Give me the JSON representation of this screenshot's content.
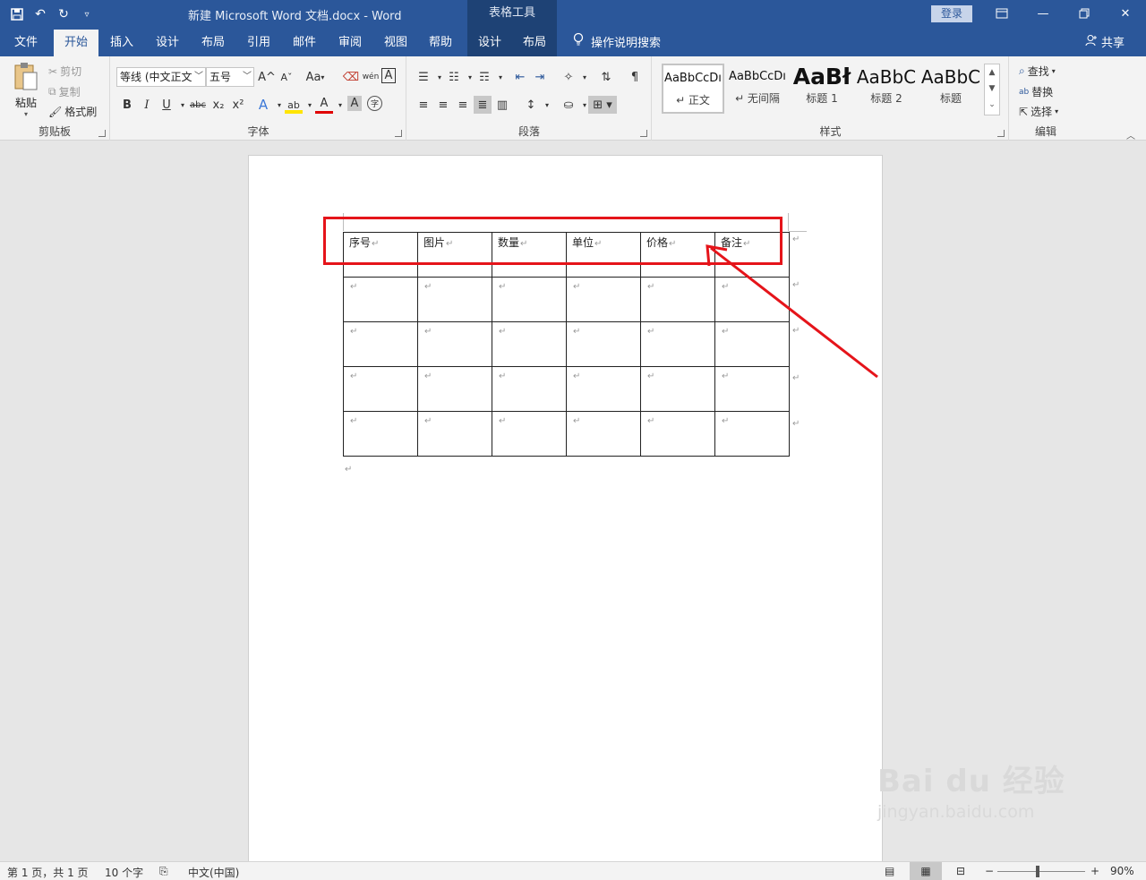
{
  "title_bar": {
    "doc_title": "新建 Microsoft Word 文档.docx  -  Word",
    "context_header": "表格工具",
    "login": "登录"
  },
  "tabs": [
    {
      "label": "文件"
    },
    {
      "label": "开始"
    },
    {
      "label": "插入"
    },
    {
      "label": "设计"
    },
    {
      "label": "布局"
    },
    {
      "label": "引用"
    },
    {
      "label": "邮件"
    },
    {
      "label": "审阅"
    },
    {
      "label": "视图"
    },
    {
      "label": "帮助"
    },
    {
      "label": "设计"
    },
    {
      "label": "布局"
    }
  ],
  "tell_me": "操作说明搜索",
  "share": "共享",
  "ribbon": {
    "clipboard": {
      "label": "剪贴板",
      "paste": "粘贴",
      "cut": "剪切",
      "copy": "复制",
      "format_painter": "格式刷"
    },
    "font": {
      "label": "字体",
      "font_name": "等线 (中文正文",
      "font_size": "五号",
      "change_case": "Aa",
      "wen": "wén",
      "char_border": "A",
      "bold": "B",
      "italic": "I",
      "underline": "U",
      "strike": "abc",
      "subscript": "x₂",
      "superscript": "x²",
      "text_effect": "A",
      "highlight": "ab",
      "font_color": "A",
      "shading": "A",
      "enclose": "字",
      "grow": "A^",
      "shrink": "Aˇ"
    },
    "paragraph": {
      "label": "段落"
    },
    "styles": {
      "label": "样式",
      "items": [
        {
          "preview": "AaBbCcDı",
          "name": "↵ 正文"
        },
        {
          "preview": "AaBbCcDı",
          "name": "↵ 无间隔"
        },
        {
          "preview": "AaBł",
          "name": "标题 1"
        },
        {
          "preview": "AaBbC",
          "name": "标题 2"
        },
        {
          "preview": "AaBbC",
          "name": "标题"
        }
      ]
    },
    "editing": {
      "label": "编辑",
      "find": "查找",
      "replace": "替换",
      "select": "选择"
    }
  },
  "table": {
    "headers": [
      "序号",
      "图片",
      "数量",
      "单位",
      "价格",
      "备注"
    ],
    "para_mark": "↵"
  },
  "status_bar": {
    "page": "第 1 页，共 1 页",
    "words": "10 个字",
    "language": "中文(中国)",
    "zoom_minus": "−",
    "zoom_plus": "+",
    "zoom": "90%"
  },
  "watermark": {
    "brand": "Bai du 经验",
    "url": "jingyan.baidu.com"
  },
  "colors": {
    "word_blue": "#2b579a",
    "context_blue": "#1e4275",
    "highlight_red": "#e5141a"
  }
}
